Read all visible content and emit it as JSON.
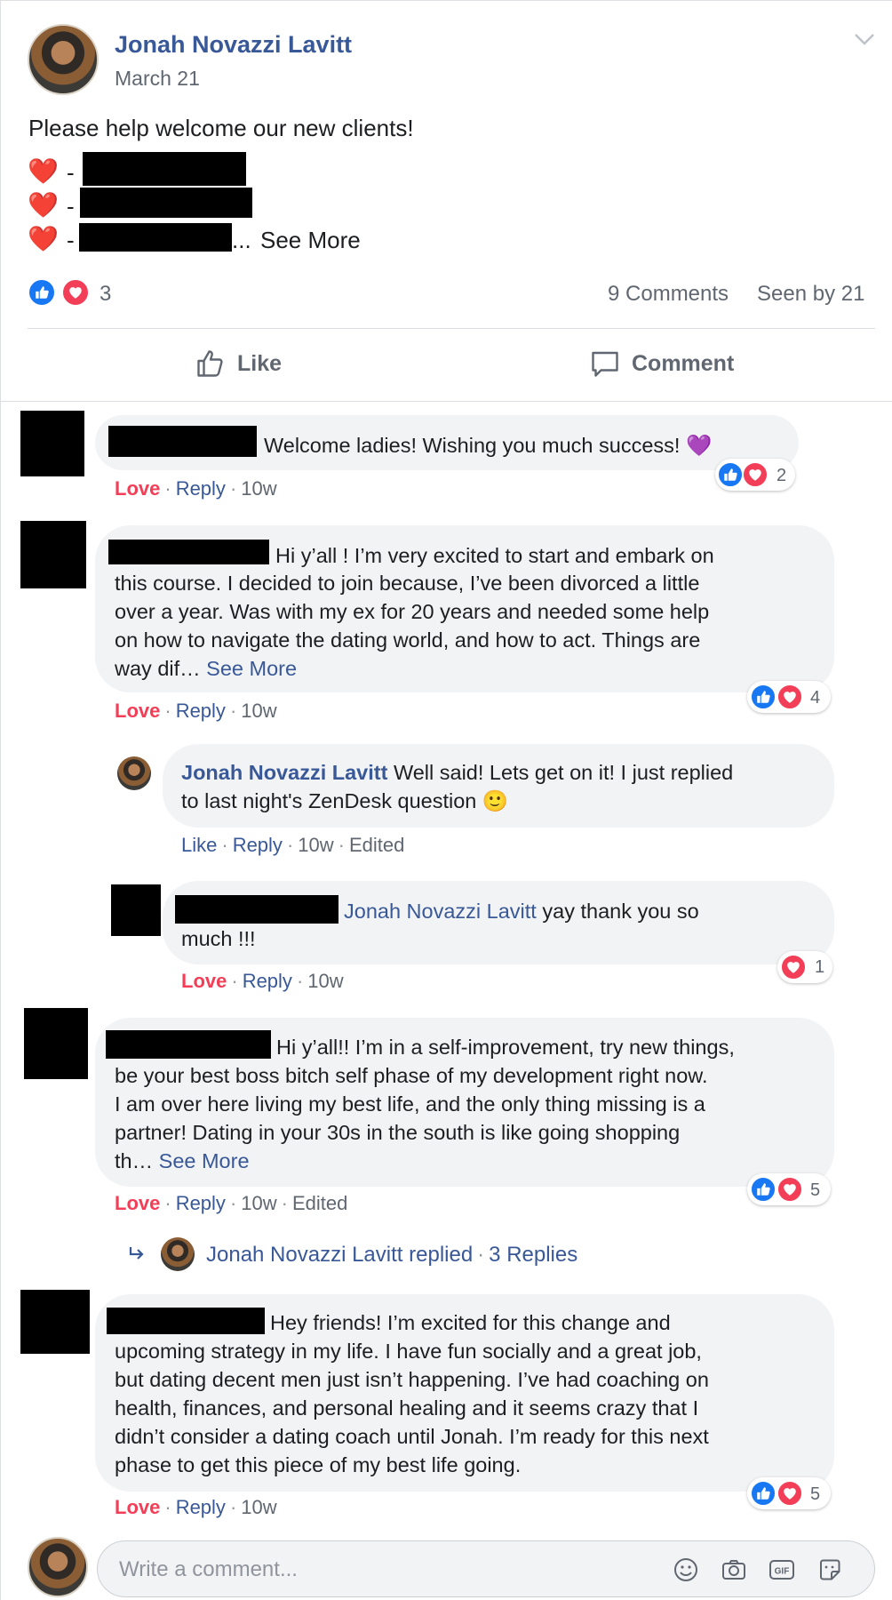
{
  "post": {
    "author": "Jonah Novazzi Lavitt",
    "date": "March 21",
    "text": "Please help welcome our new clients!",
    "list_prefix": "-",
    "ellipsis": "...",
    "see_more": "See More",
    "reaction_count": "3",
    "comments_count": "9 Comments",
    "seen_by": "Seen by 21",
    "like_label": "Like",
    "comment_label": "Comment"
  },
  "comments": [
    {
      "text": "Welcome ladies! Wishing you much success! 💜",
      "reaction": "Love",
      "reply": "Reply",
      "time": "10w",
      "count": "2"
    },
    {
      "lines": [
        "Hi y’all ! I’m very excited to start and embark on",
        "this course. I decided to join because, I’ve been divorced a little",
        "over a year. Was with my ex for 20 years and needed some help",
        "on how to navigate the dating world, and how to act. Things are",
        "way dif…"
      ],
      "see_more": "See More",
      "reaction": "Love",
      "reply": "Reply",
      "time": "10w",
      "count": "4",
      "replies": [
        {
          "author": "Jonah Novazzi Lavitt",
          "line1": "Well said! Lets get on it! I just replied",
          "line2": "to last night's ZenDesk question 🙂",
          "reaction": "Like",
          "reply": "Reply",
          "time": "10w",
          "edited": "Edited"
        },
        {
          "mention": "Jonah Novazzi Lavitt",
          "line1": "yay thank you so",
          "line2": "much !!!",
          "reaction": "Love",
          "reply": "Reply",
          "time": "10w",
          "count": "1"
        }
      ]
    },
    {
      "lines": [
        "Hi y’all!! I’m in a self-improvement, try new things,",
        "be your best boss bitch self phase of my development right now.",
        "I am over here living my best life, and the only thing missing is a",
        "partner! Dating in your 30s in the south is like going shopping",
        "th…"
      ],
      "see_more": "See More",
      "reaction": "Love",
      "reply": "Reply",
      "time": "10w",
      "edited": "Edited",
      "count": "5",
      "replied_author": "Jonah Novazzi Lavitt",
      "replied_text": "replied",
      "replies_count": "3 Replies"
    },
    {
      "lines": [
        "Hey friends! I’m excited for this change and",
        "upcoming strategy in my life. I have fun socially and a great job,",
        "but dating decent men just isn’t happening. I’ve had coaching on",
        "health, finances, and personal healing and it seems crazy that I",
        "didn’t consider a dating coach until Jonah. I’m ready for this next",
        "phase to get this piece of my best life going."
      ],
      "reaction": "Love",
      "reply": "Reply",
      "time": "10w",
      "count": "5"
    }
  ],
  "composer": {
    "placeholder": "Write a comment..."
  },
  "colors": {
    "link": "#385898",
    "love": "#f33e58",
    "like": "#1877f2",
    "bubble": "#f2f3f5"
  },
  "icons": [
    "chevron-down-icon",
    "like-icon",
    "love-icon",
    "thumbs-up-outline-icon",
    "comment-outline-icon",
    "reply-arrow-icon",
    "emoji-icon",
    "camera-icon",
    "gif-icon",
    "sticker-icon"
  ]
}
